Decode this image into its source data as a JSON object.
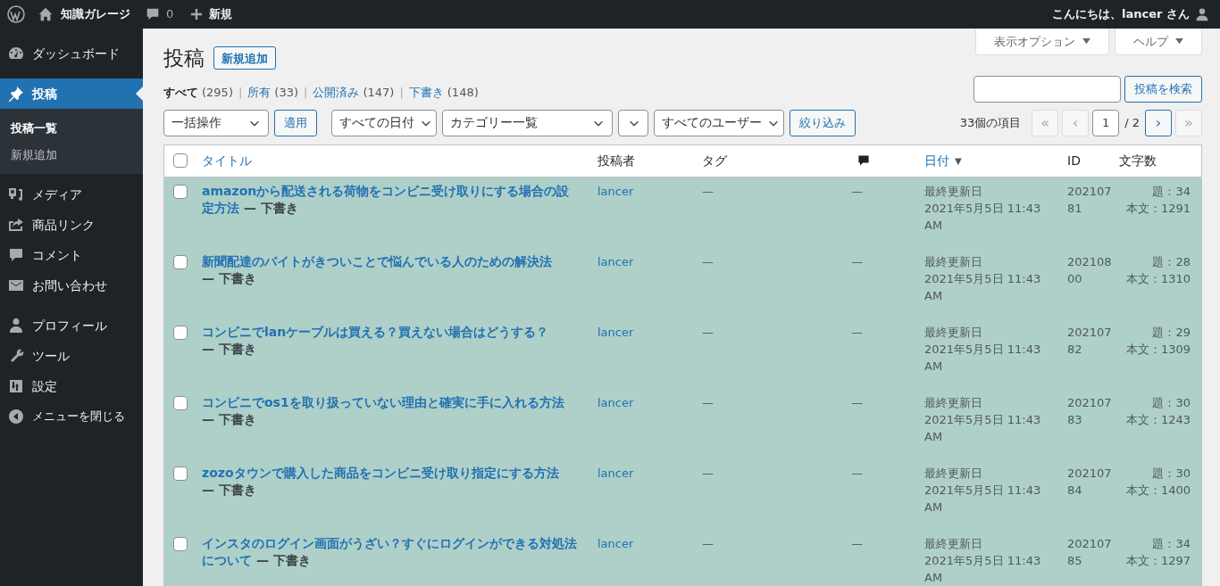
{
  "admin_bar": {
    "site_name": "知識ガレージ",
    "comments_count": "0",
    "new_label": "新規",
    "greeting": "こんにちは、lancer さん"
  },
  "sidebar": {
    "items": [
      {
        "label": "ダッシュボード",
        "selected": false
      },
      {
        "label": "投稿",
        "selected": true,
        "children": [
          {
            "label": "投稿一覧",
            "selected": true
          },
          {
            "label": "新規追加",
            "selected": false
          }
        ]
      },
      {
        "label": "メディア",
        "selected": false
      },
      {
        "label": "商品リンク",
        "selected": false
      },
      {
        "label": "コメント",
        "selected": false
      },
      {
        "label": "お問い合わせ",
        "selected": false
      },
      {
        "label": "プロフィール",
        "selected": false
      },
      {
        "label": "ツール",
        "selected": false
      },
      {
        "label": "設定",
        "selected": false
      },
      {
        "label": "メニューを閉じる",
        "selected": false
      }
    ]
  },
  "screen_options": "表示オプション",
  "help": "ヘルプ",
  "page_title": "投稿",
  "add_new": "新規追加",
  "filters": [
    {
      "label": "すべて",
      "count": "(295)",
      "selected": true
    },
    {
      "separator": "|",
      "label": "所有",
      "count": "(33)",
      "selected": false
    },
    {
      "separator": "|",
      "label": "公開済み",
      "count": "(147)",
      "selected": false
    },
    {
      "separator": "|",
      "label": "下書き",
      "count": "(148)",
      "selected": false
    }
  ],
  "search_button": "投稿を検索",
  "bulk_action": "一括操作",
  "apply": "適用",
  "date_filter": "すべての日付",
  "category_filter": "カテゴリー一覧",
  "user_filter": "すべてのユーザー",
  "filter_button": "絞り込み",
  "pagination": {
    "items_count": "33個の項目",
    "current": "1",
    "total": "/ 2",
    "buttons": [
      {
        "label": "«",
        "disabled": true
      },
      {
        "label": "‹",
        "disabled": true
      },
      {
        "label": "›",
        "disabled": false
      },
      {
        "label": "»",
        "disabled": true
      }
    ]
  },
  "table": {
    "columns": [
      "タイトル",
      "投稿者",
      "タグ",
      "",
      "日付",
      "ID",
      "文字数"
    ],
    "sort_arrow": "▼",
    "select_all_checked": false,
    "rows": [
      {
        "title": "amazonから配送される荷物をコンビニ受け取りにする場合の設定方法",
        "state": "— 下書き",
        "author": "lancer",
        "tags": "—",
        "comments": "—",
        "date_label": "最終更新日",
        "date": "2021年5月5日 11:43 AM",
        "id": "20210781",
        "title_count": "題：34",
        "body_count": "本文：1291",
        "checked": false
      },
      {
        "title": "新聞配達のバイトがきついことで悩んでいる人のための解決法",
        "state": "— 下書き",
        "author": "lancer",
        "tags": "—",
        "comments": "—",
        "date_label": "最終更新日",
        "date": "2021年5月5日 11:43 AM",
        "id": "20210800",
        "title_count": "題：28",
        "body_count": "本文：1310",
        "checked": false
      },
      {
        "title": "コンビニでlanケーブルは買える？買えない場合はどうする？",
        "state": "— 下書き",
        "author": "lancer",
        "tags": "—",
        "comments": "—",
        "date_label": "最終更新日",
        "date": "2021年5月5日 11:43 AM",
        "id": "20210782",
        "title_count": "題：29",
        "body_count": "本文：1309",
        "checked": false
      },
      {
        "title": "コンビニでos1を取り扱っていない理由と確実に手に入れる方法",
        "state": "— 下書き",
        "author": "lancer",
        "tags": "—",
        "comments": "—",
        "date_label": "最終更新日",
        "date": "2021年5月5日 11:43 AM",
        "id": "20210783",
        "title_count": "題：30",
        "body_count": "本文：1243",
        "checked": false
      },
      {
        "title": "zozoタウンで購入した商品をコンビニ受け取り指定にする方法",
        "state": "— 下書き",
        "author": "lancer",
        "tags": "—",
        "comments": "—",
        "date_label": "最終更新日",
        "date": "2021年5月5日 11:43 AM",
        "id": "20210784",
        "title_count": "題：30",
        "body_count": "本文：1400",
        "checked": false
      },
      {
        "title": "インスタのログイン画面がうざい？すぐにログインができる対処法について",
        "state": "— 下書き",
        "author": "lancer",
        "tags": "—",
        "comments": "—",
        "date_label": "最終更新日",
        "date": "2021年5月5日 11:43 AM",
        "id": "20210785",
        "title_count": "題：34",
        "body_count": "本文：1297",
        "checked": false
      }
    ]
  }
}
